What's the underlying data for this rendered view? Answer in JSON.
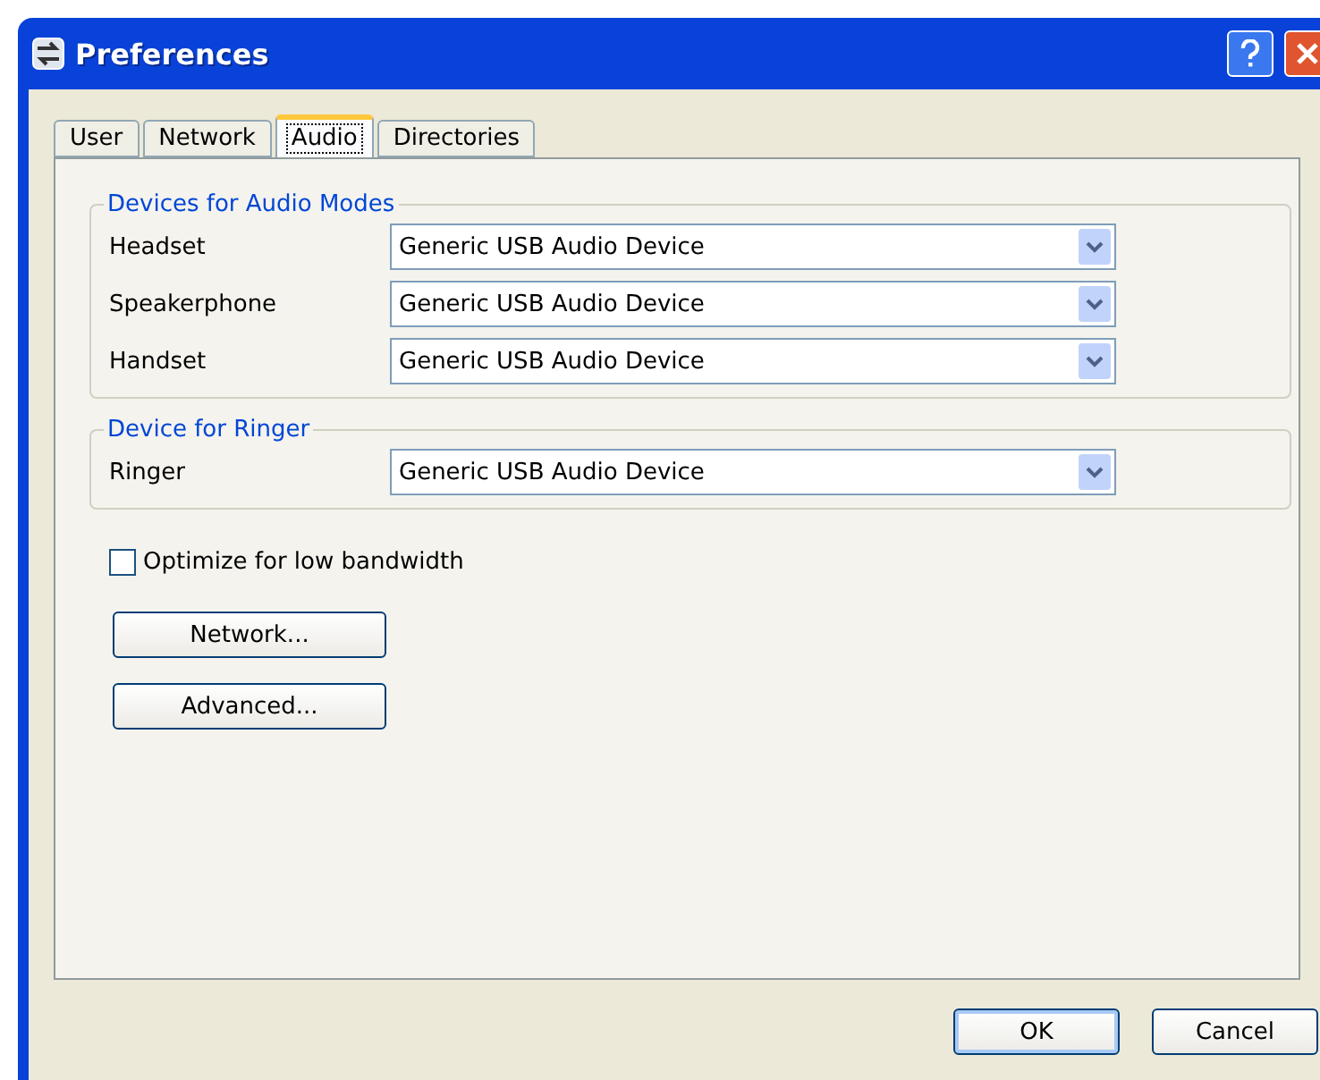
{
  "window": {
    "title": "Preferences"
  },
  "tabs": [
    {
      "label": "User",
      "selected": false
    },
    {
      "label": "Network",
      "selected": false
    },
    {
      "label": "Audio",
      "selected": true
    },
    {
      "label": "Directories",
      "selected": false
    }
  ],
  "groups": [
    {
      "title": "Devices for Audio Modes",
      "rows": [
        {
          "label": "Headset",
          "value": "Generic USB Audio Device"
        },
        {
          "label": "Speakerphone",
          "value": "Generic USB Audio Device"
        },
        {
          "label": "Handset",
          "value": "Generic USB Audio Device"
        }
      ]
    },
    {
      "title": "Device for Ringer",
      "rows": [
        {
          "label": "Ringer",
          "value": "Generic USB Audio Device"
        }
      ]
    }
  ],
  "checkbox": {
    "label": "Optimize for low bandwidth",
    "checked": false
  },
  "buttons": [
    "Network...",
    "Advanced..."
  ],
  "footer_buttons": [
    {
      "label": "OK",
      "default": true
    },
    {
      "label": "Cancel",
      "default": false
    }
  ]
}
